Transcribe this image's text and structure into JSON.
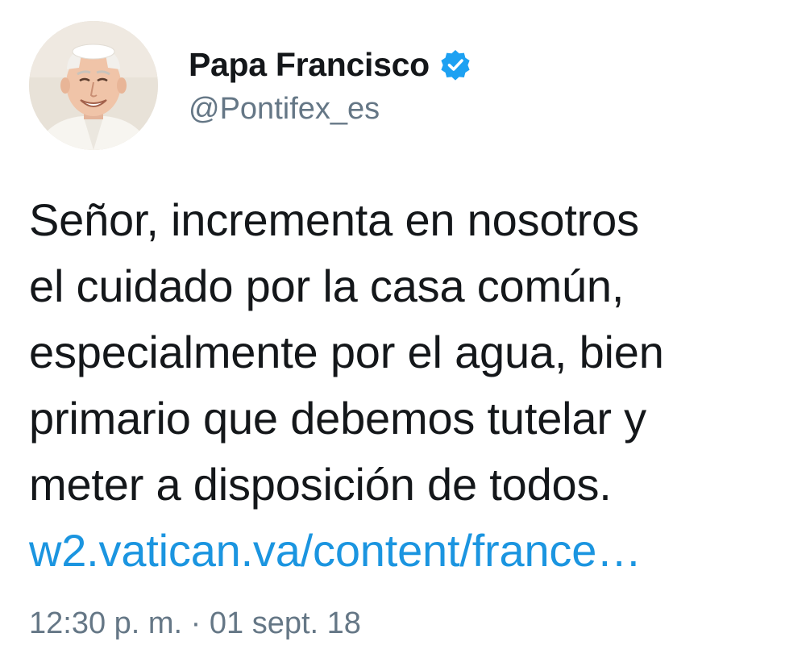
{
  "author": {
    "display_name": "Papa Francisco",
    "handle": "@Pontifex_es",
    "verified_icon": "verified-badge-icon",
    "avatar_icon": "profile-photo"
  },
  "tweet": {
    "lines": [
      "Señor, incrementa en nosotros",
      "el cuidado por la casa común,",
      "especialmente por el agua, bien",
      "primario que debemos tutelar y",
      "meter a disposición de todos."
    ],
    "link_text": "w2.vatican.va/content/france…",
    "timestamp": "12:30 p. m. · 01 sept. 18"
  },
  "colors": {
    "text": "#14171a",
    "secondary": "#657786",
    "link": "#1b95e0",
    "verified": "#1da1f2",
    "background": "#ffffff"
  }
}
